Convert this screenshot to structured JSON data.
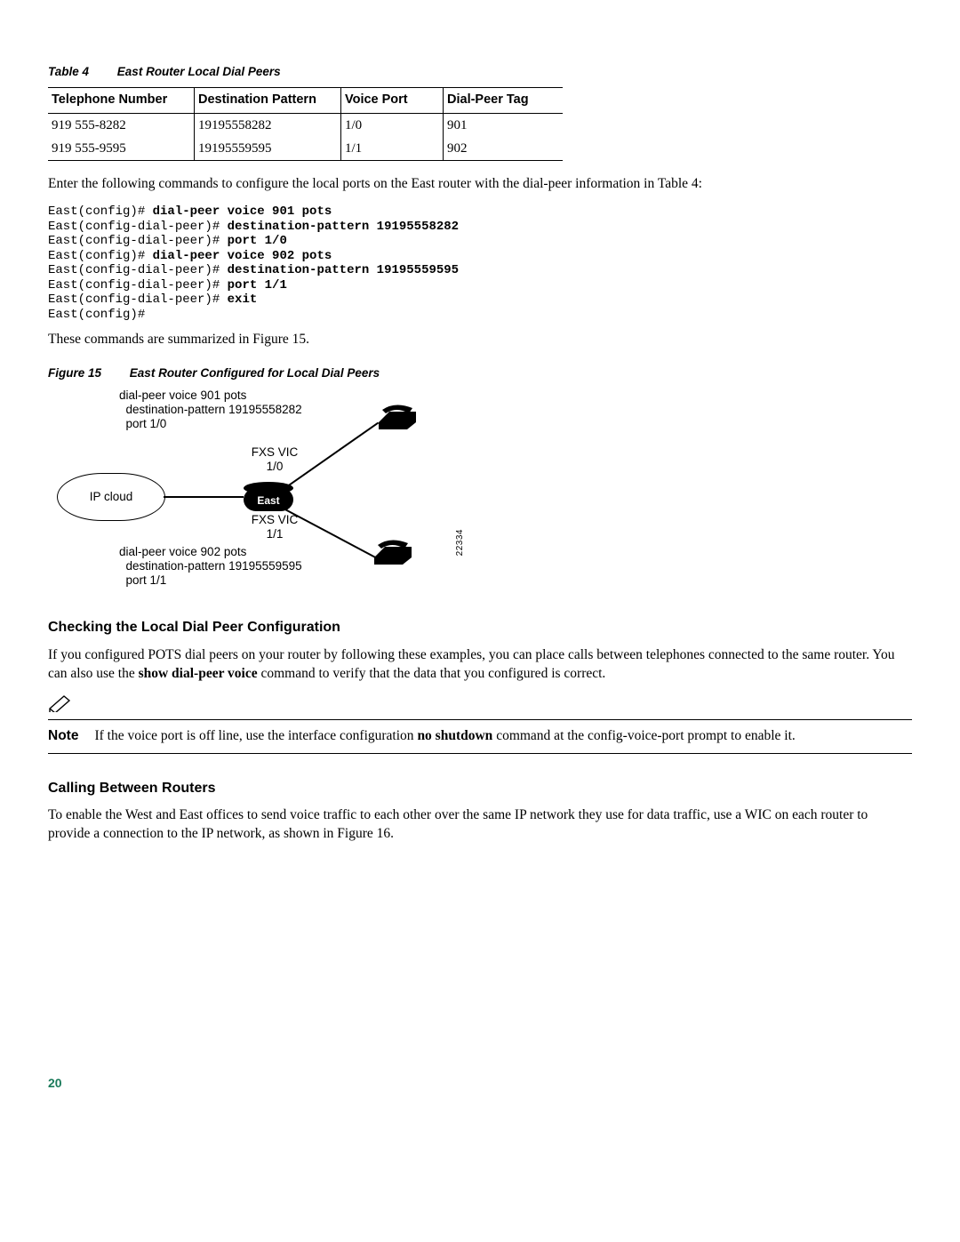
{
  "table4": {
    "caption_num": "Table 4",
    "caption_title": "East Router Local Dial Peers",
    "headers": [
      "Telephone Number",
      "Destination Pattern",
      "Voice Port",
      "Dial-Peer Tag"
    ],
    "rows": [
      [
        "919 555-8282",
        "19195558282",
        "1/0",
        "901"
      ],
      [
        "919 555-9595",
        "19195559595",
        "1/1",
        "902"
      ]
    ]
  },
  "intro_para": "Enter the following commands to configure the local ports on the East router with the dial-peer information in Table 4:",
  "cli": {
    "p1": "East(config)# ",
    "c1": "dial-peer voice 901 pots",
    "p2": "East(config-dial-peer)# ",
    "c2": "destination-pattern 19195558282",
    "p3": "East(config-dial-peer)# ",
    "c3": "port 1/0",
    "p4": "East(config)# ",
    "c4": "dial-peer voice 902 pots",
    "p5": "East(config-dial-peer)# ",
    "c5": "destination-pattern 19195559595",
    "p6": "East(config-dial-peer)# ",
    "c6": "port 1/1",
    "p7": "East(config-dial-peer)# ",
    "c7": "exit",
    "p8": "East(config)#"
  },
  "summary_para": "These commands are summarized in Figure 15.",
  "figure15": {
    "caption_num": "Figure 15",
    "caption_title": "East Router Configured for Local Dial Peers",
    "top_cfg_l1": "dial-peer voice 901 pots",
    "top_cfg_l2": "destination-pattern 19195558282",
    "top_cfg_l3": "port 1/0",
    "fxs_top_l1": "FXS VIC",
    "fxs_top_l2": "1/0",
    "cloud": "IP cloud",
    "router": "East",
    "fxs_bot_l1": "FXS VIC",
    "fxs_bot_l2": "1/1",
    "bot_cfg_l1": "dial-peer voice 902 pots",
    "bot_cfg_l2": "destination-pattern 19195559595",
    "bot_cfg_l3": "port 1/1",
    "id": "22334"
  },
  "section1_title": "Checking the Local Dial Peer Configuration",
  "section1_para_a": "If you configured POTS dial peers on your router by following these examples, you can place calls between telephones connected to the same router. You can also use the ",
  "section1_para_bold": "show dial-peer voice",
  "section1_para_b": " command to verify that the data that you configured is correct.",
  "note": {
    "label": "Note",
    "text_a": "If the voice port is off line, use the interface configuration ",
    "text_bold": "no shutdown",
    "text_b": " command at the config-voice-port prompt to enable it."
  },
  "section2_title": "Calling Between Routers",
  "section2_para": "To enable the West and East offices to send voice traffic to each other over the same IP network they use for data traffic, use a WIC on each router to provide a connection to the IP network, as shown in Figure 16.",
  "page_number": "20"
}
